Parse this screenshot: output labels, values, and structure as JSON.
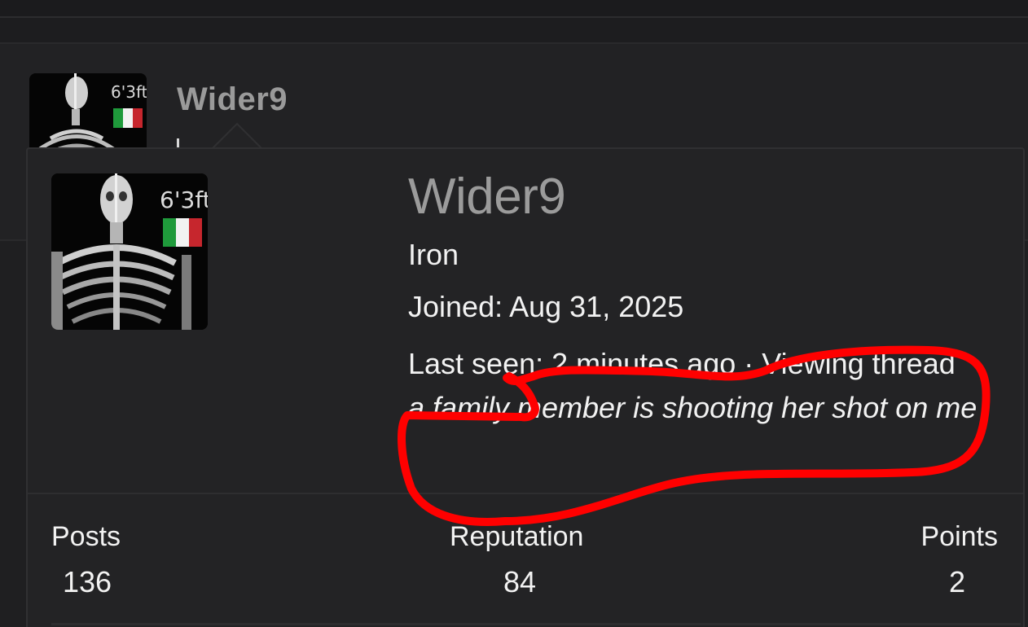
{
  "background_post": {
    "username": "Wider9",
    "role_fragment": "I"
  },
  "avatar": {
    "height_text": "6'3ft",
    "flag": "italy-flag-icon"
  },
  "tooltip": {
    "username": "Wider9",
    "role": "Iron",
    "joined": "Joined: Aug 31, 2025",
    "last_seen_prefix": "Last seen: 2 minutes ago · Viewing thread ",
    "last_seen_thread": "a family member is shooting her shot on me"
  },
  "stats": {
    "posts_label": "Posts",
    "posts_value": "136",
    "reputation_label": "Reputation",
    "reputation_value": "84",
    "points_label": "Points",
    "points_value": "2"
  },
  "colors": {
    "background": "#1f1f21",
    "card": "#232325",
    "username_gray": "#9b9b9b",
    "text": "#f2f2f2",
    "annotation_red": "#ff0000"
  }
}
